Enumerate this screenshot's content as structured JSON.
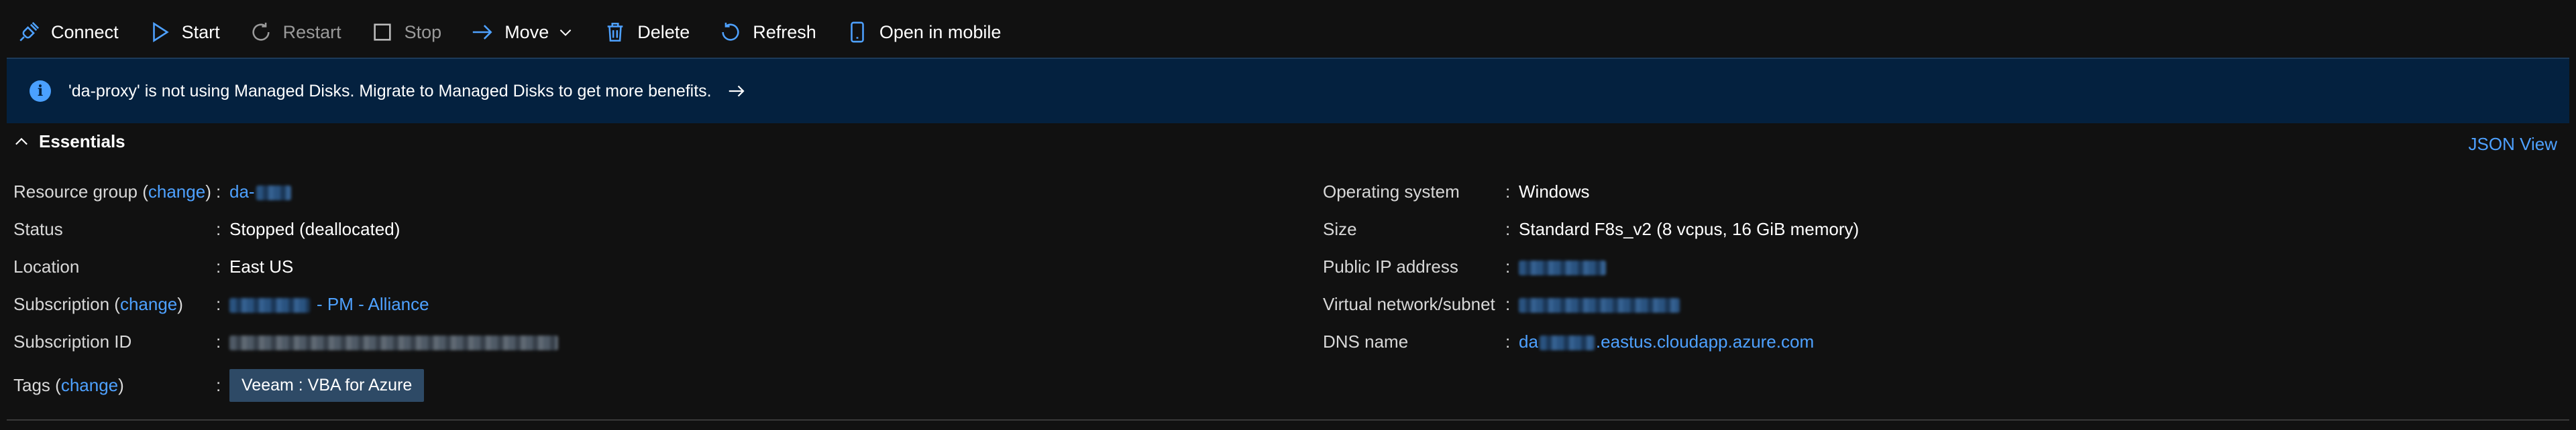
{
  "toolbar": {
    "connect": "Connect",
    "start": "Start",
    "restart": "Restart",
    "stop": "Stop",
    "move": "Move",
    "delete": "Delete",
    "refresh": "Refresh",
    "open_mobile": "Open in mobile"
  },
  "banner": {
    "message": "'da-proxy' is not using Managed Disks. Migrate to Managed Disks to get more benefits."
  },
  "essentials": {
    "title": "Essentials",
    "json_view": "JSON View",
    "left": {
      "resource_group_label": "Resource group (",
      "change_label": "change",
      "close_paren": ")",
      "resource_group_value": "da-",
      "status_label": "Status",
      "status_value": "Stopped (deallocated)",
      "location_label": "Location",
      "location_value": "East US",
      "subscription_label": "Subscription (",
      "subscription_value": "- PM - Alliance",
      "subscription_id_label": "Subscription ID",
      "tags_label": "Tags (",
      "tag_value": "Veeam : VBA for Azure"
    },
    "right": {
      "os_label": "Operating system",
      "os_value": "Windows",
      "size_label": "Size",
      "size_value": "Standard F8s_v2 (8 vcpus, 16 GiB memory)",
      "public_ip_label": "Public IP address",
      "vnet_label": "Virtual network/subnet",
      "dns_label": "DNS name",
      "dns_prefix": "da",
      "dns_suffix": ".eastus.cloudapp.azure.com"
    },
    "separator": ":"
  },
  "colors": {
    "accent": "#4ea1ff",
    "banner_bg": "#04213f",
    "page_bg": "#111111",
    "tag_bg": "#2e4a66"
  }
}
